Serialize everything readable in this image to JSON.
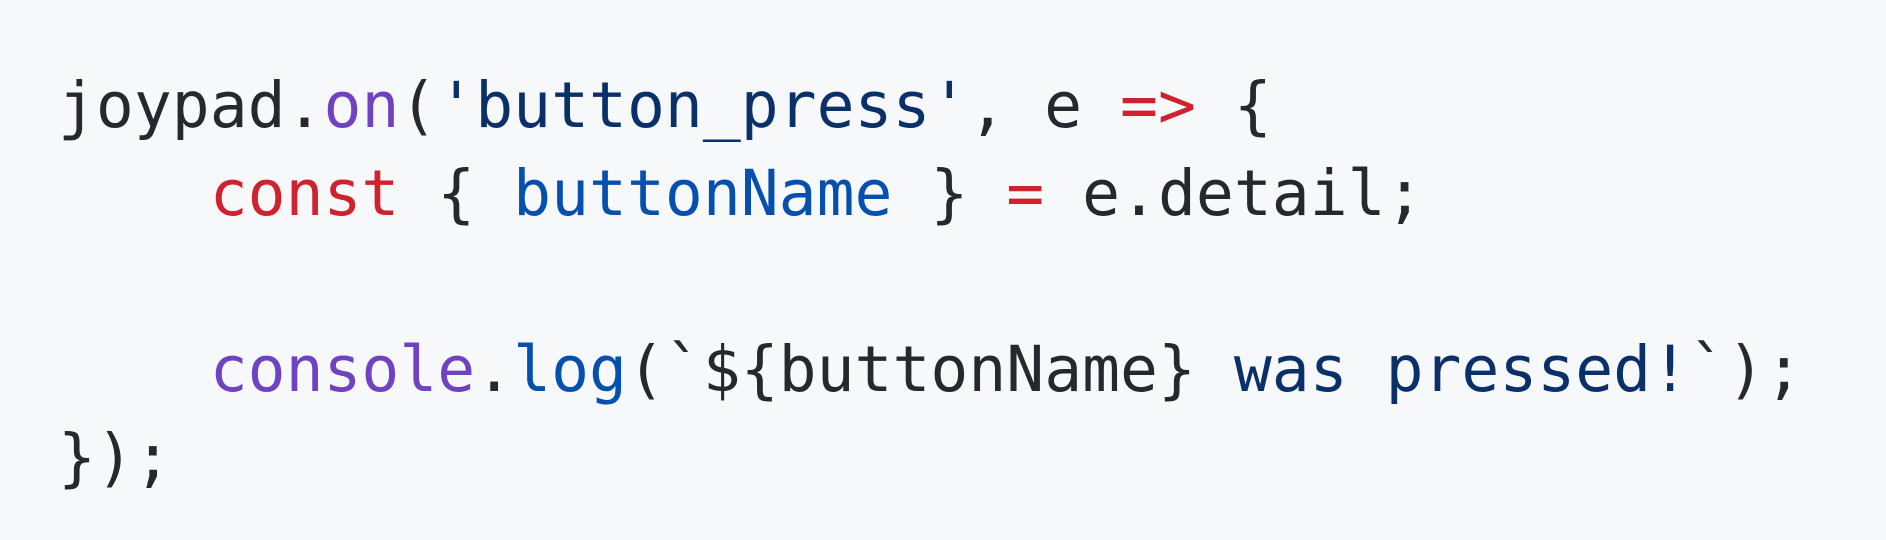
{
  "colors": {
    "background": "#f6f8fa",
    "plain": "#24292f",
    "keyword": "#cf222e",
    "function": "#6f42c1",
    "property": "#0550ae",
    "string": "#0a3069",
    "operator": "#cf222e"
  },
  "code": {
    "language": "javascript",
    "lines": [
      {
        "tokens": [
          {
            "text": "joypad",
            "kind": "plain"
          },
          {
            "text": ".",
            "kind": "plain"
          },
          {
            "text": "on",
            "kind": "function"
          },
          {
            "text": "(",
            "kind": "plain"
          },
          {
            "text": "'button_press'",
            "kind": "string"
          },
          {
            "text": ", e ",
            "kind": "plain"
          },
          {
            "text": "=>",
            "kind": "operator"
          },
          {
            "text": " {",
            "kind": "plain"
          }
        ]
      },
      {
        "tokens": [
          {
            "text": "    ",
            "kind": "plain"
          },
          {
            "text": "const",
            "kind": "keyword"
          },
          {
            "text": " { ",
            "kind": "plain"
          },
          {
            "text": "buttonName",
            "kind": "property"
          },
          {
            "text": " } ",
            "kind": "plain"
          },
          {
            "text": "=",
            "kind": "operator"
          },
          {
            "text": " e.detail;",
            "kind": "plain"
          }
        ]
      },
      {
        "tokens": [
          {
            "text": "",
            "kind": "plain"
          }
        ]
      },
      {
        "tokens": [
          {
            "text": "    ",
            "kind": "plain"
          },
          {
            "text": "console",
            "kind": "function"
          },
          {
            "text": ".",
            "kind": "plain"
          },
          {
            "text": "log",
            "kind": "property"
          },
          {
            "text": "(`",
            "kind": "plain"
          },
          {
            "text": "${buttonName}",
            "kind": "plain"
          },
          {
            "text": " was pressed!",
            "kind": "string"
          },
          {
            "text": "`);",
            "kind": "plain"
          }
        ]
      },
      {
        "tokens": [
          {
            "text": "});",
            "kind": "plain"
          }
        ]
      }
    ]
  }
}
